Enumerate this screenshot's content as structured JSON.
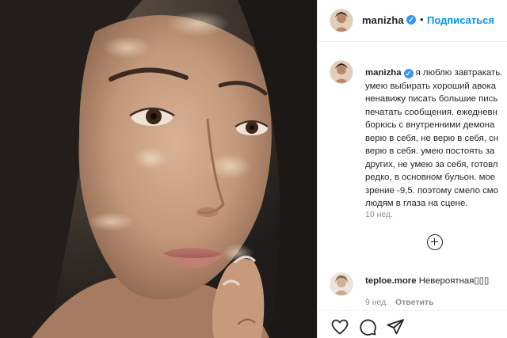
{
  "post": {
    "username": "manizha",
    "follow_label": "Подписаться",
    "separator": "•",
    "caption_lines": [
      "я люблю завтракать.",
      "умею выбирать хороший авока",
      "ненавижу писать большие пись",
      "печатать сообщения. ежедневн",
      "борюсь с внутренними демона",
      "верю в себя, не верю в себя, сн",
      "верю в себя. умею постоять за",
      "других, не умею за себя, готовл",
      "редко, в основном бульон. мое",
      "зрение -9,5. поэтому смело смо",
      "людям в глаза на сцене."
    ],
    "caption_time": "10 нед."
  },
  "comment": {
    "username": "teploe.more",
    "text": "Невероятная▯▯▯",
    "time": "9 нед.",
    "reply_label": "Ответить"
  },
  "icons": {
    "verified": "verified-badge-icon",
    "load_more": "plus-circle-icon",
    "like": "heart-icon",
    "comment": "comment-icon",
    "share": "paper-plane-icon"
  },
  "colors": {
    "follow": "#0095f6",
    "verified": "#3897f0",
    "text": "#262626",
    "muted": "#8e8e8e"
  }
}
